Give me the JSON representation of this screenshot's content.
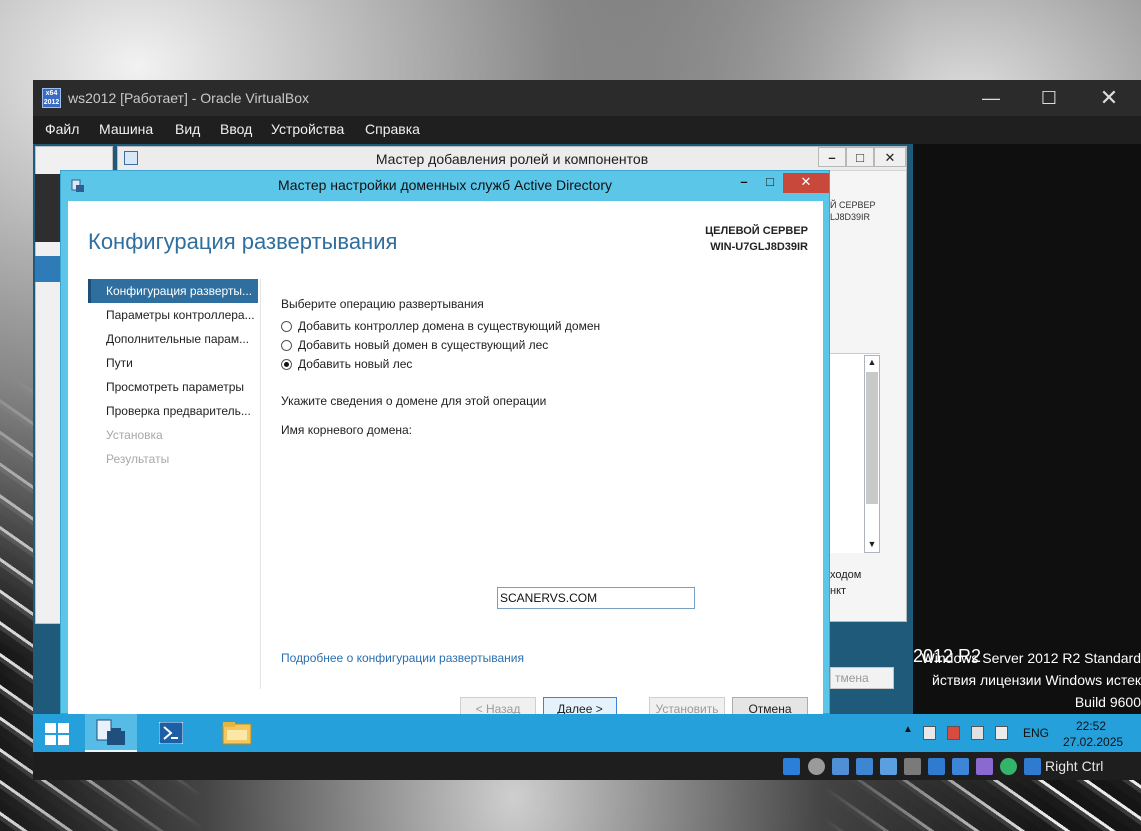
{
  "vbox": {
    "title": "ws2012 [Работает] - Oracle VirtualBox",
    "logo_text": "x64 2012",
    "menu": [
      "Файл",
      "Машина",
      "Вид",
      "Ввод",
      "Устройства",
      "Справка"
    ],
    "status_host_key": "Right Ctrl"
  },
  "roles_wizard": {
    "title": "Мастер добавления ролей и компонентов",
    "target_line1": "Й СЕРВЕР",
    "target_line2": "LJ8D39IR",
    "side_text_line1": "ходом",
    "side_text_line2": "нкт",
    "cancel_label": "тмена"
  },
  "ad_wizard": {
    "title": "Мастер настройки доменных служб Active Directory",
    "page_title": "Конфигурация развертывания",
    "target_label": "ЦЕЛЕВОЙ СЕРВЕР",
    "target_server": "WIN-U7GLJ8D39IR",
    "nav": [
      {
        "label": "Конфигурация разверты...",
        "state": "active"
      },
      {
        "label": "Параметры контроллера...",
        "state": "normal"
      },
      {
        "label": "Дополнительные парам...",
        "state": "normal"
      },
      {
        "label": "Пути",
        "state": "normal"
      },
      {
        "label": "Просмотреть параметры",
        "state": "normal"
      },
      {
        "label": "Проверка предваритель...",
        "state": "normal"
      },
      {
        "label": "Установка",
        "state": "disabled"
      },
      {
        "label": "Результаты",
        "state": "disabled"
      }
    ],
    "operation_prompt": "Выберите операцию развертывания",
    "options": [
      {
        "label": "Добавить контроллер домена в существующий домен",
        "checked": false
      },
      {
        "label": "Добавить новый домен в существующий лес",
        "checked": false
      },
      {
        "label": "Добавить новый лес",
        "checked": true
      }
    ],
    "domain_prompt": "Укажите сведения о домене для этой операции",
    "root_domain_label": "Имя корневого домена:",
    "root_domain_value": "SCANERVS.COM",
    "more_link": "Подробнее о конфигурации развертывания",
    "buttons": {
      "back": "< Назад",
      "next": "Далее >",
      "install": "Установить",
      "cancel": "Отмена"
    }
  },
  "watermark": {
    "logo": "2012 R2",
    "line1": "Windows Server 2012 R2 Standard",
    "line2": "йствия лицензии Windows истек",
    "line3": "Build 9600"
  },
  "taskbar": {
    "language": "ENG",
    "time": "22:52",
    "date": "27.02.2025"
  }
}
